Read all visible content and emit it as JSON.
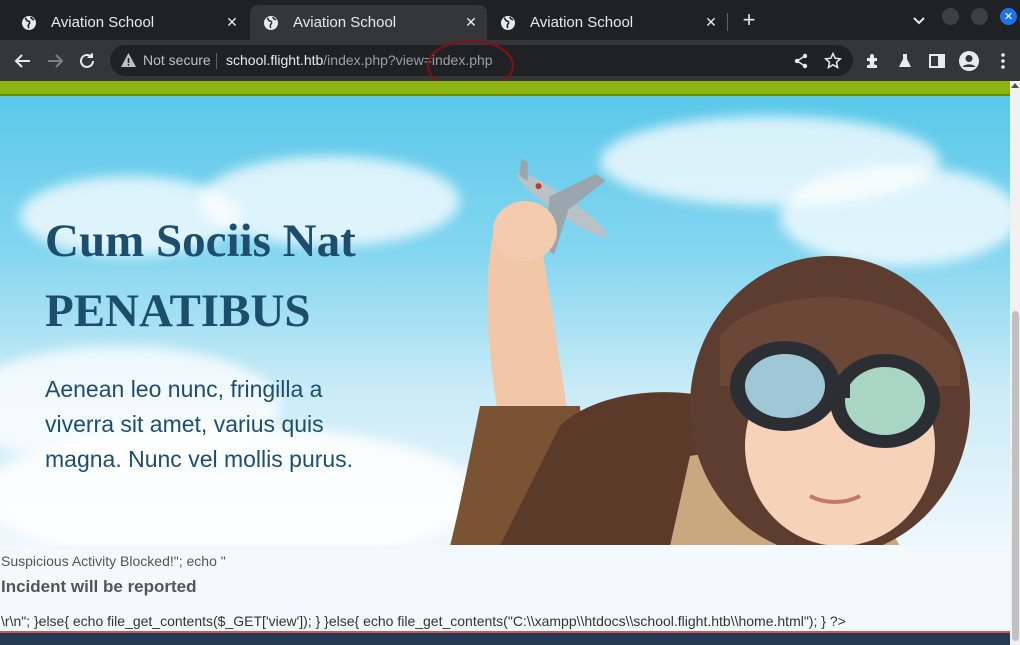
{
  "tabs": [
    {
      "title": "Aviation School",
      "icon": "globe-icon"
    },
    {
      "title": "Aviation School",
      "icon": "globe-icon",
      "active": true
    },
    {
      "title": "Aviation School",
      "icon": "globe-icon"
    }
  ],
  "toolbar": {
    "security_label": "Not secure",
    "url_host": "school.flight.htb",
    "url_path": "/index.php?view=index.php"
  },
  "hero": {
    "title_line1": "Cum Sociis Nat",
    "title_line2": "PENATIBUS",
    "subtitle": "Aenean leo nunc, fringilla a viverra sit amet, varius quis magna. Nunc vel mollis purus."
  },
  "output": {
    "line1": "Suspicious Activity Blocked!\"; echo \"",
    "line2": "Incident will be reported",
    "line3": "\\r\\n\"; }else{ echo file_get_contents($_GET['view']); } }else{ echo file_get_contents(\"C:\\\\xampp\\\\htdocs\\\\school.flight.htb\\\\home.html\"); } ?>"
  },
  "colors": {
    "accent_green": "#8cb410",
    "hero_text": "#1e4e6e",
    "annotation_red": "#8b0d12"
  }
}
